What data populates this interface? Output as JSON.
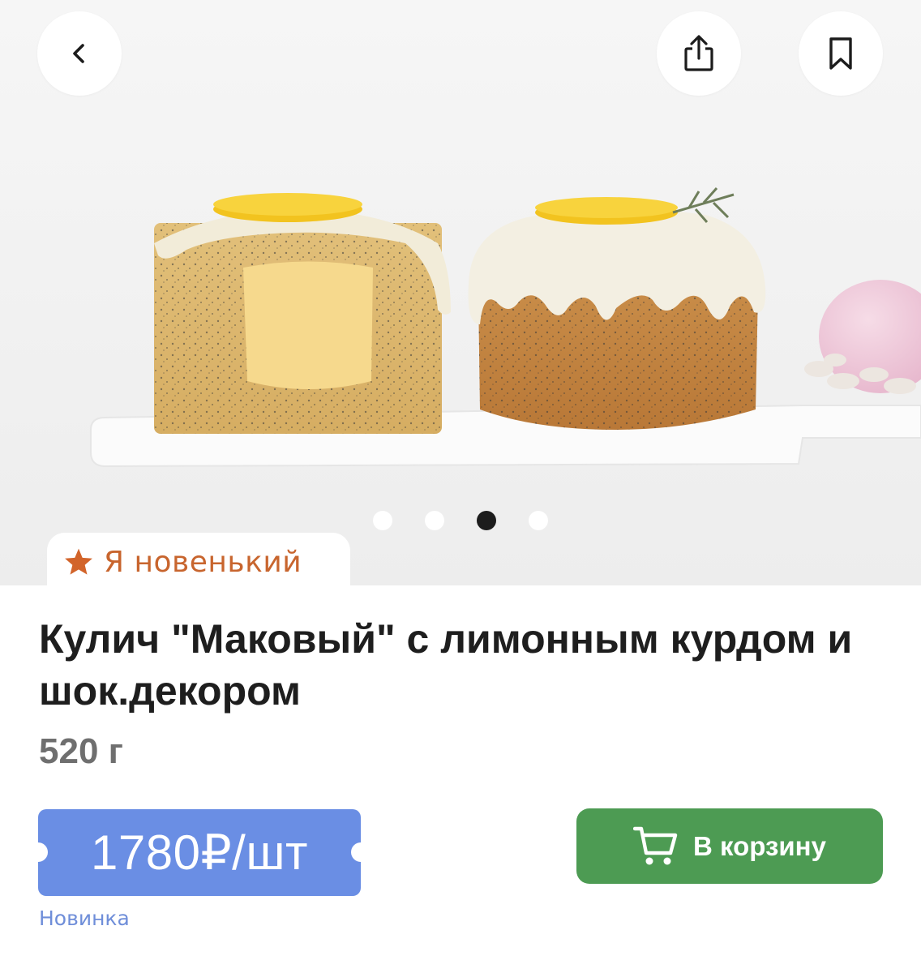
{
  "header": {
    "back_icon": "chevron-left-icon",
    "share_icon": "share-icon",
    "bookmark_icon": "bookmark-icon"
  },
  "gallery": {
    "image_count": 4,
    "active_index": 2
  },
  "badge": {
    "icon": "star-icon",
    "label": "Я новенький",
    "color": "#c8652e"
  },
  "product": {
    "title": "Кулич \"Маковый\" с лимонным курдом и шок.декором",
    "weight": "520 г",
    "price": "1780₽/шт",
    "tag": "Новинка"
  },
  "actions": {
    "add_to_cart_label": "В корзину",
    "cart_icon": "cart-icon"
  },
  "colors": {
    "price_bg": "#6a8ee4",
    "cart_bg": "#4d9b53",
    "badge_text": "#c8652e",
    "new_label": "#6f8ed9"
  }
}
